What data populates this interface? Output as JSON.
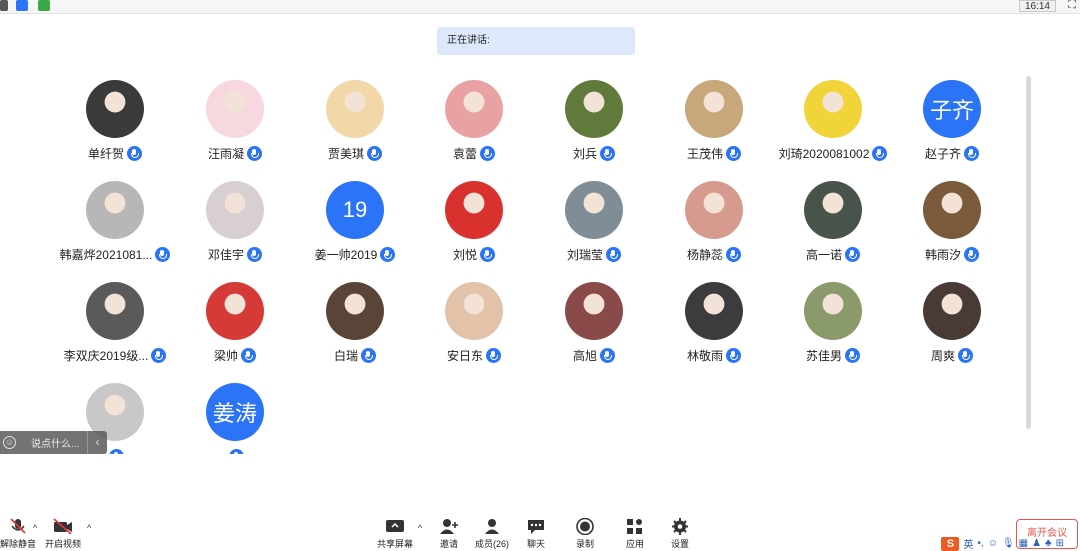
{
  "topbar": {
    "clock": "16:14",
    "fullscreen_icon": "fullscreen-icon"
  },
  "speaking": {
    "label": "正在讲话:"
  },
  "participants": [
    {
      "name": "单纤贺",
      "avatar_kind": "photo",
      "color": "#3a3a3a"
    },
    {
      "name": "汪雨凝",
      "avatar_kind": "photo",
      "color": "#f6d8de"
    },
    {
      "name": "贾美琪",
      "avatar_kind": "photo",
      "color": "#f2d7a8"
    },
    {
      "name": "袁蕾",
      "avatar_kind": "photo",
      "color": "#e9a2a4"
    },
    {
      "name": "刘兵",
      "avatar_kind": "photo",
      "color": "#5f7a3a"
    },
    {
      "name": "王茂伟",
      "avatar_kind": "photo",
      "color": "#c8a77a"
    },
    {
      "name": "刘琦2020081002",
      "avatar_kind": "photo",
      "color": "#f1d33a"
    },
    {
      "name": "赵子齐",
      "avatar_kind": "text",
      "avatar_text": "子齐"
    },
    {
      "name": "韩嘉烨2021081...",
      "avatar_kind": "photo",
      "color": "#b9b6b7"
    },
    {
      "name": "邓佳宇",
      "avatar_kind": "photo",
      "color": "#d7cfd2"
    },
    {
      "name": "姜一帅2019",
      "avatar_kind": "text",
      "avatar_text": "19"
    },
    {
      "name": "刘悦",
      "avatar_kind": "photo",
      "color": "#d8312e"
    },
    {
      "name": "刘瑞莹",
      "avatar_kind": "photo",
      "color": "#7f8d97"
    },
    {
      "name": "杨静蕊",
      "avatar_kind": "photo",
      "color": "#d79a8e"
    },
    {
      "name": "高一诺",
      "avatar_kind": "photo",
      "color": "#48544a"
    },
    {
      "name": "韩雨汐",
      "avatar_kind": "photo",
      "color": "#7a5a3a"
    },
    {
      "name": "李双庆2019级...",
      "avatar_kind": "photo",
      "color": "#5a5a5a"
    },
    {
      "name": "梁帅",
      "avatar_kind": "photo",
      "color": "#d53a36"
    },
    {
      "name": "白瑞",
      "avatar_kind": "photo",
      "color": "#5a4438"
    },
    {
      "name": "安日东",
      "avatar_kind": "photo",
      "color": "#e2c2a8"
    },
    {
      "name": "高旭",
      "avatar_kind": "photo",
      "color": "#8a4a4a"
    },
    {
      "name": "林敬雨",
      "avatar_kind": "photo",
      "color": "#3c3c3e"
    },
    {
      "name": "苏佳男",
      "avatar_kind": "photo",
      "color": "#8a9a6a"
    },
    {
      "name": "周爽",
      "avatar_kind": "photo",
      "color": "#4a3a36"
    },
    {
      "name": "",
      "avatar_kind": "photo",
      "color": "#c9c7c8"
    },
    {
      "name": "",
      "avatar_kind": "text",
      "avatar_text": "姜涛"
    }
  ],
  "chat": {
    "placeholder": "说点什么...",
    "collapse_icon": "chevron-left-icon"
  },
  "toolbar": {
    "mute": "解除静音",
    "video": "开启视频",
    "share": "共享屏幕",
    "invite": "邀请",
    "members": "成员(26)",
    "chat": "聊天",
    "record": "录制",
    "apps": "应用",
    "settings": "设置",
    "leave": "离开会议"
  },
  "ime": {
    "logo": "S",
    "mode": "英"
  },
  "colors": {
    "accent": "#2b73f7",
    "leave": "#e8554e",
    "speaking_bg": "#dde9fb"
  }
}
